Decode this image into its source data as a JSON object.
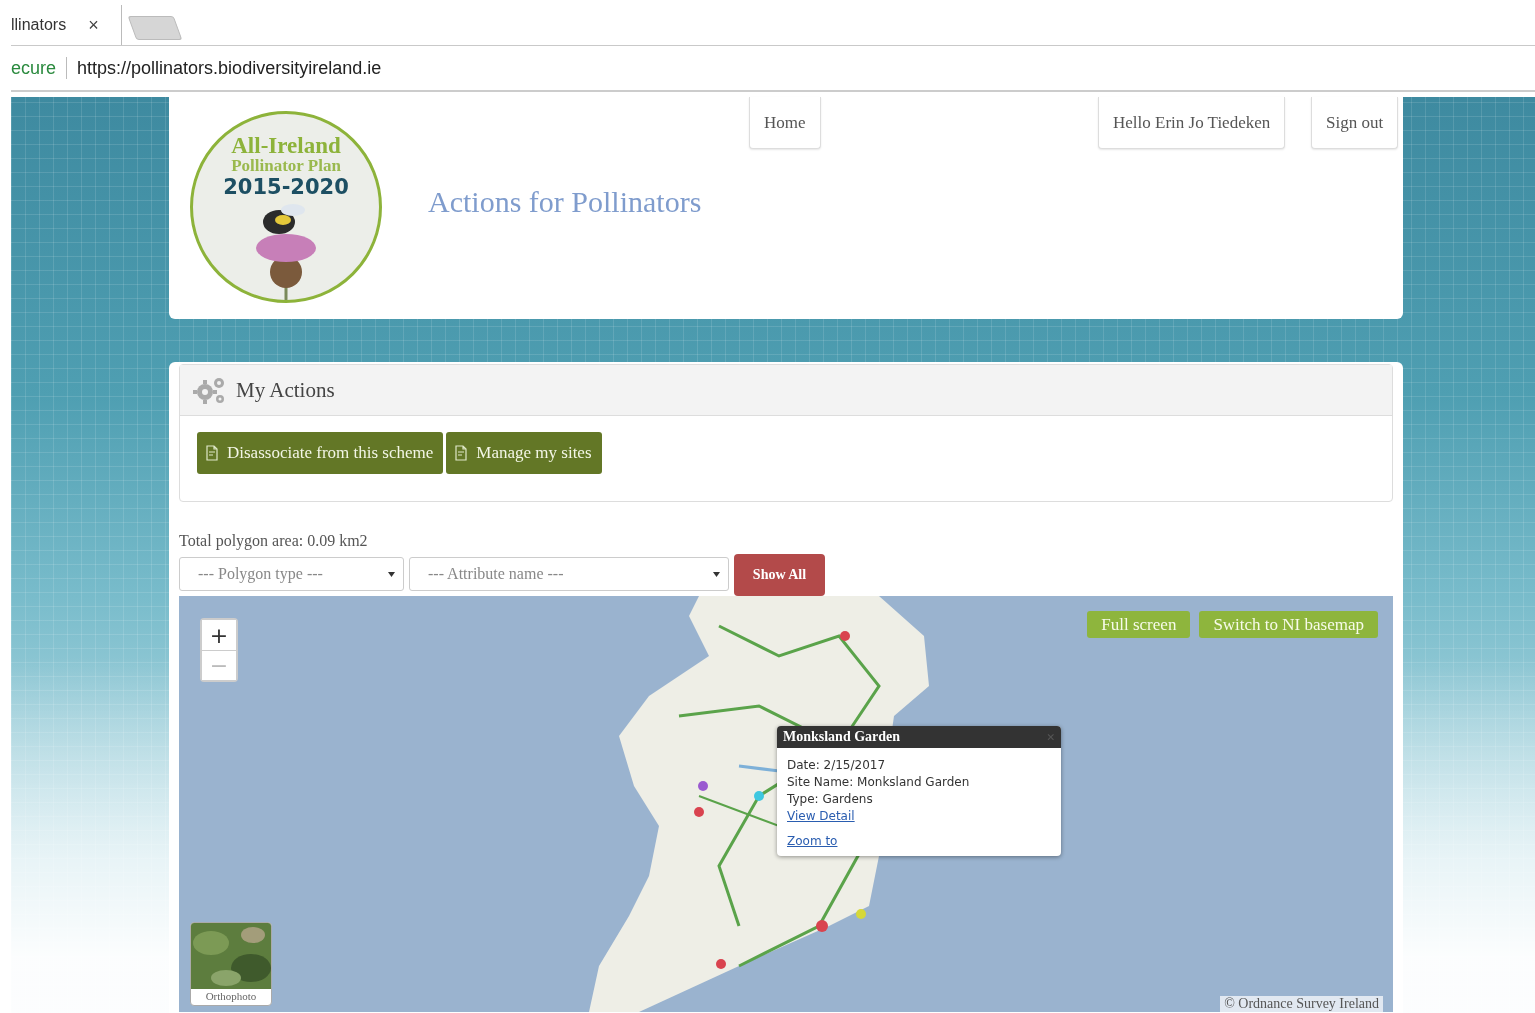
{
  "browser": {
    "tab": {
      "title": "llinators",
      "close": "×"
    },
    "address": {
      "security": "ecure",
      "url": "https://pollinators.biodiversityireland.ie"
    }
  },
  "header": {
    "logo": {
      "lines": [
        "All-Ireland",
        "Pollinator Plan",
        "2015-2020"
      ]
    },
    "title": "Actions for Pollinators",
    "nav": [
      {
        "label": "Home"
      },
      {
        "label": "Hello Erin Jo Tiedeken"
      },
      {
        "label": "Sign out"
      }
    ]
  },
  "actions_panel": {
    "title": "My Actions",
    "buttons": [
      "Disassociate from this scheme",
      "Manage my sites"
    ]
  },
  "total_area": "Total polygon area: 0.09 km2",
  "filters": [
    {
      "placeholder": "--- Polygon type ---"
    },
    {
      "placeholder": "--- Attribute name ---"
    }
  ],
  "show_all": "Show All",
  "map": {
    "zoom": [
      "+",
      "−"
    ],
    "buttons": [
      "Full screen",
      "Switch to NI basemap"
    ],
    "popup": {
      "title": "Monksland Garden",
      "close": "×",
      "lines": [
        "Date: 2/15/2017",
        "Site Name: Monksland Garden",
        "Type: Gardens"
      ],
      "links": [
        "View Detail",
        "Zoom to"
      ]
    },
    "layer_switch": {
      "label": "Orthophoto"
    },
    "attribution": "© Ordnance Survey Ireland"
  }
}
